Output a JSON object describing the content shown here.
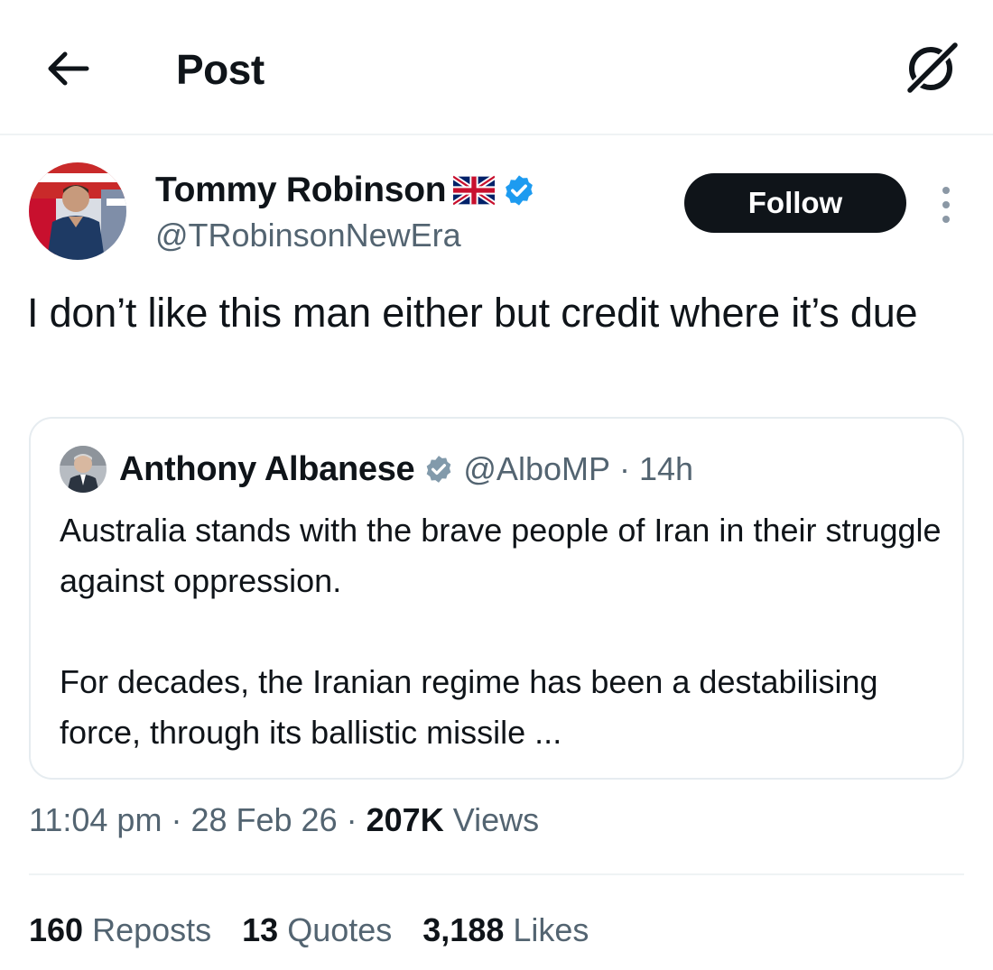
{
  "header": {
    "title": "Post",
    "back_icon": "arrow-left-icon",
    "grok_icon": "grok-icon"
  },
  "author": {
    "name": "Tommy Robinson",
    "flag_icon": "uk-flag-icon",
    "verified_icon": "verified-badge-icon",
    "handle": "@TRobinsonNewEra",
    "follow_label": "Follow",
    "more_icon": "more-vertical-icon"
  },
  "post": {
    "text": "I don’t like this man either but credit where it’s due"
  },
  "quote": {
    "name": "Anthony Albanese",
    "verified_icon": "gray-verified-badge-icon",
    "handle": "@AlboMP",
    "separator": "·",
    "time": "14h",
    "text": "Australia stands with the brave people of Iran in their struggle against oppression.\n\nFor decades, the Iranian regime has been a destabilising force, through its ballistic missile ..."
  },
  "meta": {
    "time": "11:04 pm",
    "sep1": "·",
    "date": "28 Feb 26",
    "sep2": "·",
    "views_count": "207K",
    "views_label": "Views"
  },
  "stats": {
    "reposts_count": "160",
    "reposts_label": "Reposts",
    "quotes_count": "13",
    "quotes_label": "Quotes",
    "likes_count": "3,188",
    "likes_label": "Likes"
  },
  "colors": {
    "text": "#0f1419",
    "secondary": "#536471",
    "verified_blue": "#1d9bf0",
    "verified_gray": "#829aab",
    "border": "#e6ecf0"
  }
}
